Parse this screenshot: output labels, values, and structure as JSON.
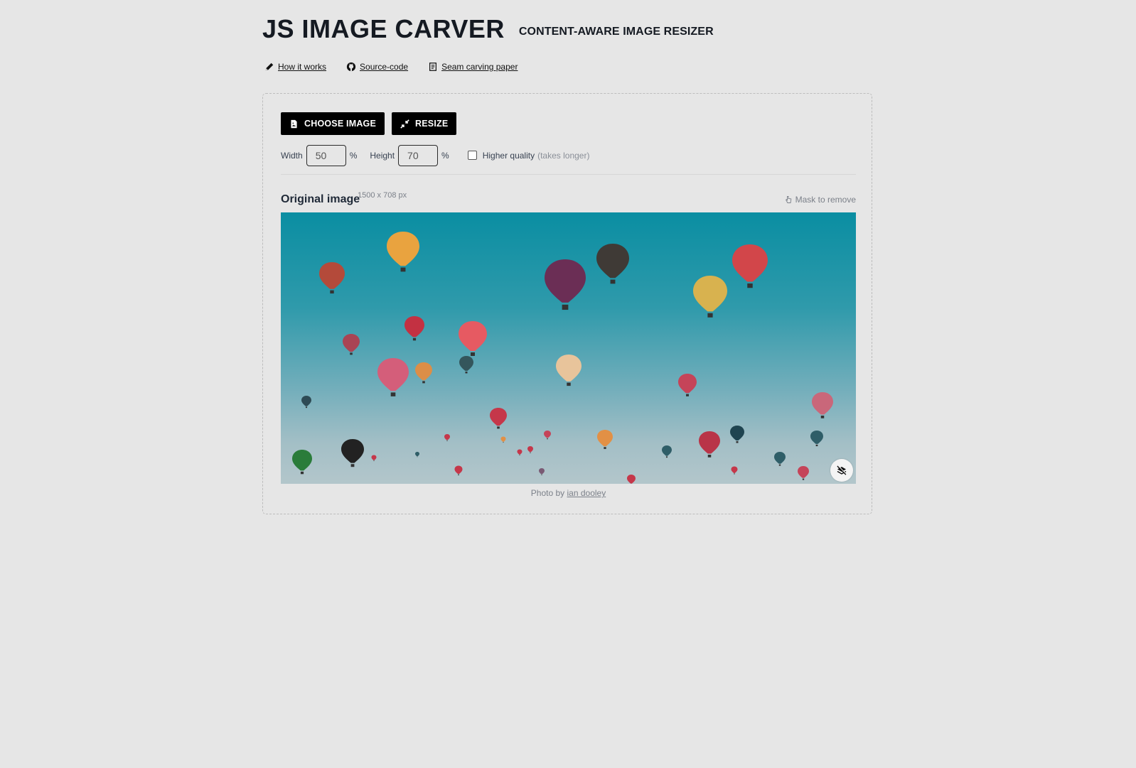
{
  "header": {
    "title": "JS IMAGE CARVER",
    "subtitle": "CONTENT-AWARE IMAGE RESIZER"
  },
  "nav": {
    "how_it_works": "How it works",
    "source_code": "Source-code",
    "paper": "Seam carving paper"
  },
  "toolbar": {
    "choose_label": "CHOOSE IMAGE",
    "resize_label": "RESIZE"
  },
  "controls": {
    "width_label": "Width",
    "width_value": "50",
    "height_label": "Height",
    "height_value": "70",
    "percent": "%",
    "quality_label": "Higher quality",
    "quality_note": "(takes longer)",
    "quality_checked": false
  },
  "original": {
    "title": "Original image",
    "size": "1500 x 708 px",
    "mask_label": "Mask to remove"
  },
  "credit": {
    "prefix": "Photo by",
    "author": "ian dooley"
  }
}
